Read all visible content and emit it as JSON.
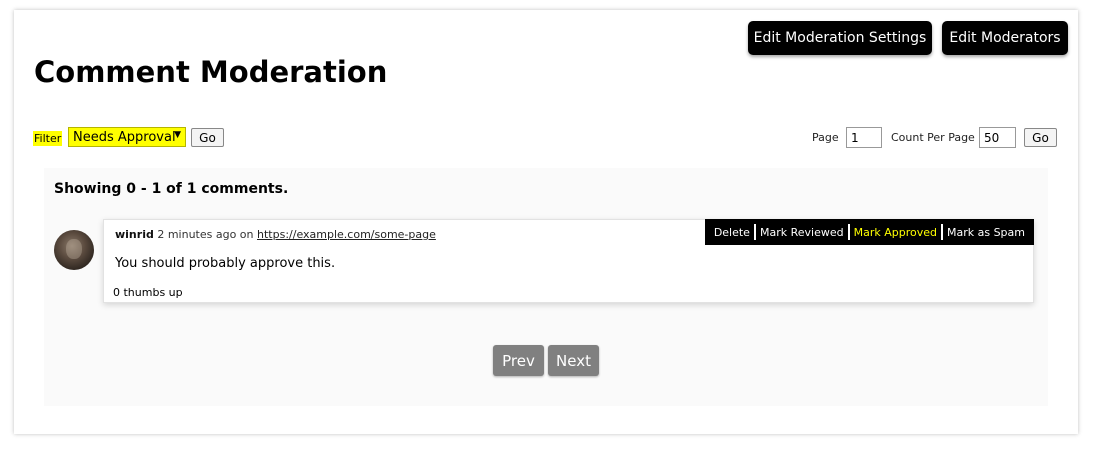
{
  "header": {
    "title": "Comment Moderation",
    "edit_settings_label": "Edit Moderation Settings",
    "edit_moderators_label": "Edit Moderators"
  },
  "filter": {
    "label": "Filter",
    "selected": "Needs Approval",
    "go_label": "Go"
  },
  "paging": {
    "page_label": "Page",
    "page_value": "1",
    "count_label": "Count Per Page",
    "count_value": "50",
    "go_label": "Go"
  },
  "results": {
    "showing": "Showing 0 - 1 of 1 comments."
  },
  "comments": [
    {
      "user": "winrid",
      "time": "2 minutes ago on",
      "url": "https://example.com/some-page",
      "text": "You should probably approve this.",
      "votes": "0 thumbs up",
      "actions": {
        "delete": "Delete",
        "mark_reviewed": "Mark Reviewed",
        "mark_approved": "Mark Approved",
        "mark_spam": "Mark as Spam"
      }
    }
  ],
  "pager": {
    "prev": "Prev",
    "next": "Next"
  },
  "colors": {
    "highlight": "#ffff00",
    "button_dark": "#000000",
    "pager_gray": "#808080"
  }
}
